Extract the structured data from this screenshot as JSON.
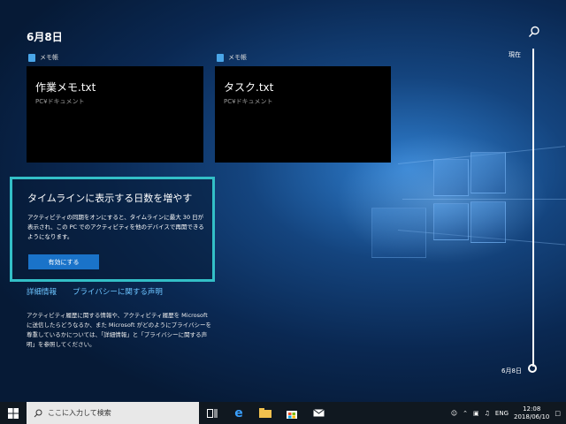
{
  "timeline": {
    "date_heading": "6月8日",
    "cards": [
      {
        "app": "メモ帳",
        "title": "作業メモ.txt",
        "subtitle": "PC¥ドキュメント"
      },
      {
        "app": "メモ帳",
        "title": "タスク.txt",
        "subtitle": "PC¥ドキュメント"
      }
    ],
    "promo": {
      "title": "タイムラインに表示する日数を増やす",
      "body": "アクティビティの同期をオンにすると、タイムラインに最大 30 日が表示され、この PC でのアクティビティを他のデバイスで再開できるようになります。",
      "button": "有効にする"
    },
    "links": {
      "details": "詳細情報",
      "privacy": "プライバシーに関する声明"
    },
    "privacy_text": "アクティビティ履歴に関する情報や、アクティビティ履歴を Microsoft に送信したらどうなるか、また Microsoft がどのようにプライバシーを尊重しているかについては、「詳細情報」と「プライバシーに関する声明」を参照してください。",
    "scrubber": {
      "top_label": "現在",
      "bottom_label": "6月8日"
    }
  },
  "taskbar": {
    "search_placeholder": "ここに入力して検索",
    "language": "ENG",
    "time": "12:08",
    "date": "2018/06/10"
  }
}
